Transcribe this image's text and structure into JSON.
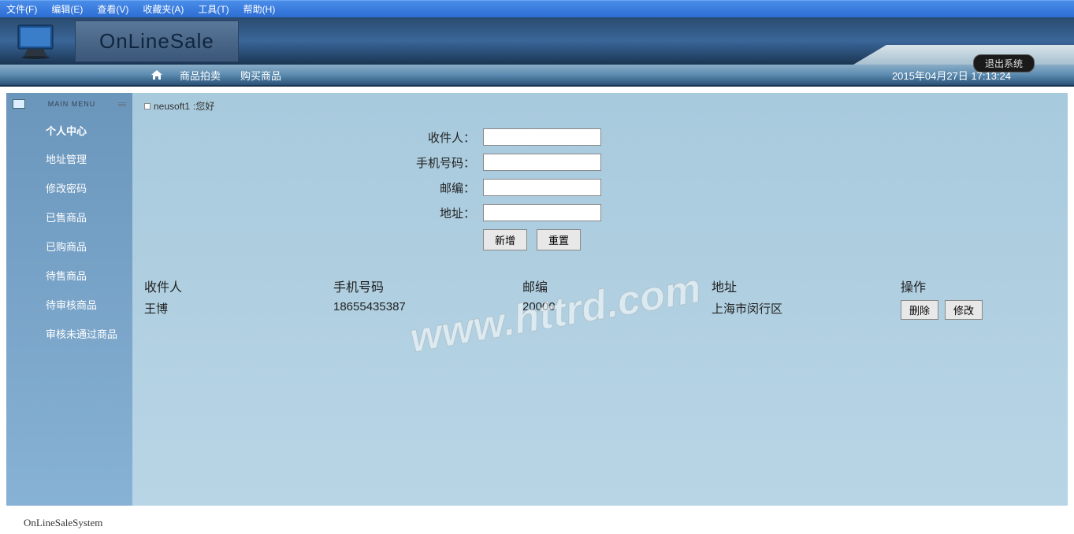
{
  "browser_menu": [
    "文件(F)",
    "编辑(E)",
    "查看(V)",
    "收藏夹(A)",
    "工具(T)",
    "帮助(H)"
  ],
  "app_title": "OnLineSale",
  "exit_label": "退出系统",
  "nav": {
    "links": [
      "商品拍卖",
      "购买商品"
    ],
    "datetime": "2015年04月27日 17:13:24"
  },
  "sidebar": {
    "main_menu_label": "MAIN MENU",
    "header": "个人中心",
    "items": [
      "地址管理",
      "修改密码",
      "已售商品",
      "已购商品",
      "待售商品",
      "待审核商品",
      "审核未通过商品"
    ]
  },
  "greeting": {
    "user": "neusoft1",
    "suffix": ":您好"
  },
  "form": {
    "labels": {
      "recipient": "收件人：",
      "phone": "手机号码：",
      "zipcode": "邮编：",
      "address": "地址："
    },
    "buttons": {
      "add": "新增",
      "reset": "重置"
    }
  },
  "table": {
    "headers": [
      "收件人",
      "手机号码",
      "邮编",
      "地址",
      "操作"
    ],
    "rows": [
      {
        "recipient": "王博",
        "phone": "18655435387",
        "zipcode": "20000",
        "address": "上海市闵行区"
      }
    ],
    "actions": {
      "delete": "删除",
      "edit": "修改"
    }
  },
  "watermark": "www.httrd.com",
  "footer": "OnLineSaleSystem"
}
